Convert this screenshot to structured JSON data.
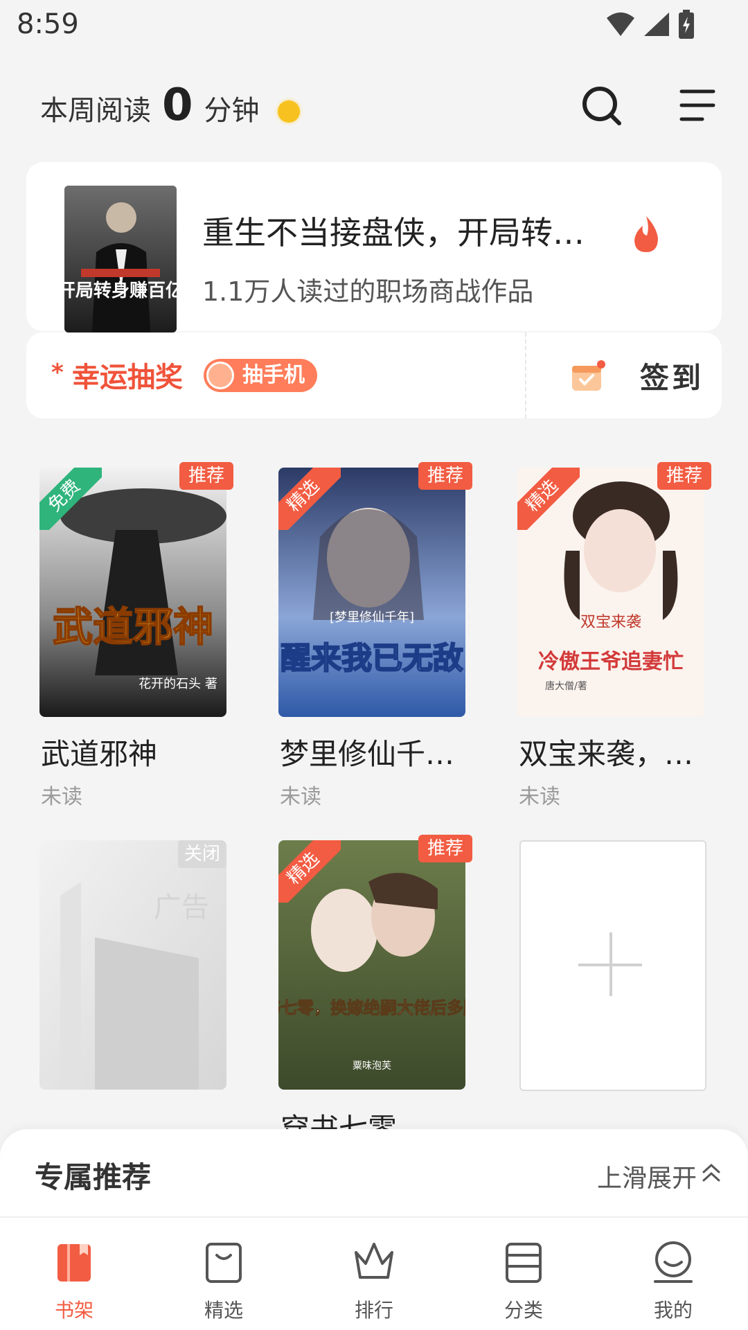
{
  "status_bar": {
    "time": "8:59"
  },
  "header": {
    "label": "本周阅读",
    "minutes": "0",
    "unit": "分钟",
    "coin_color": "#f7c21f",
    "icons": [
      "search-icon",
      "menu-icon"
    ]
  },
  "promo": {
    "title": "重生不当接盘侠，开局转…",
    "desc": "1.1万人读过的职场商战作品",
    "cover_text": "开局转身赚百亿",
    "hot_icon": "flame-icon"
  },
  "actions": {
    "lucky_star": "*",
    "lucky_label": "幸运抽奖",
    "pill_label": "抽手机",
    "signin_label": "签到"
  },
  "books": [
    {
      "name": "武道邪神",
      "status": "未读",
      "tag": "推荐",
      "corner": "免费",
      "cover_text": "武道邪神",
      "author": "花开的石头 著"
    },
    {
      "name": "梦里修仙千…",
      "status": "未读",
      "tag": "推荐",
      "corner": "精选",
      "cover_text": "醒来我已无敌",
      "cover_sub": "[梦里修仙千年]"
    },
    {
      "name": "双宝来袭，…",
      "status": "未读",
      "tag": "推荐",
      "corner": "精选",
      "cover_text": "冷傲王爷追妻忙",
      "cover_sub": "双宝来袭",
      "author": "唐大僧/著"
    },
    {
      "ad_close": "关闭",
      "ad_text": "广告"
    },
    {
      "name": "穿书七零",
      "tag": "推荐",
      "corner": "精选",
      "cover_text": "穿书七零，换嫁绝嗣大佬后多胎了",
      "author": "粟味泡芙"
    }
  ],
  "sheet": {
    "title": "专属推荐",
    "expand": "上滑展开"
  },
  "tabs": [
    {
      "label": "书架",
      "icon": "bookshelf-icon",
      "active": true
    },
    {
      "label": "精选",
      "icon": "bag-icon"
    },
    {
      "label": "排行",
      "icon": "crown-icon"
    },
    {
      "label": "分类",
      "icon": "category-icon"
    },
    {
      "label": "我的",
      "icon": "profile-icon"
    }
  ],
  "colors": {
    "accent": "#f25c42",
    "free_tag": "#2fb47c",
    "picked_tag": "#f25c42"
  }
}
